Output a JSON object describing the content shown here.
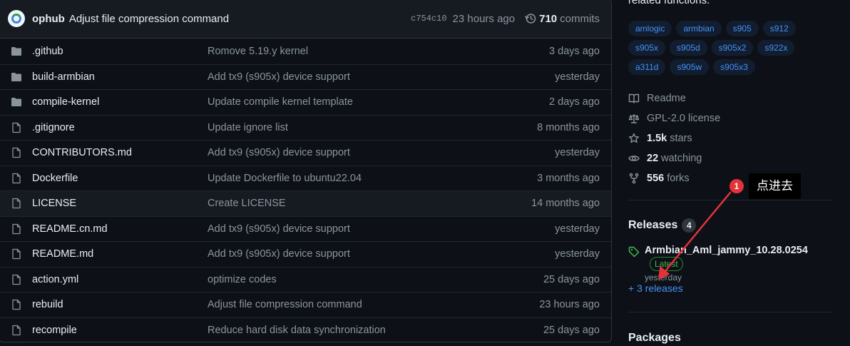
{
  "commit_bar": {
    "author": "ophub",
    "message": "Adjust file compression command",
    "sha": "c754c10",
    "time": "23 hours ago",
    "commits_count": "710",
    "commits_label": "commits"
  },
  "files": [
    {
      "type": "folder",
      "name": ".github",
      "message": "Romove 5.19.y kernel",
      "time": "3 days ago"
    },
    {
      "type": "folder",
      "name": "build-armbian",
      "message": "Add tx9 (s905x) device support",
      "time": "yesterday"
    },
    {
      "type": "folder",
      "name": "compile-kernel",
      "message": "Update compile kernel template",
      "time": "2 days ago"
    },
    {
      "type": "file",
      "name": ".gitignore",
      "message": "Update ignore list",
      "time": "8 months ago"
    },
    {
      "type": "file",
      "name": "CONTRIBUTORS.md",
      "message": "Add tx9 (s905x) device support",
      "time": "yesterday"
    },
    {
      "type": "file",
      "name": "Dockerfile",
      "message": "Update Dockerfile to ubuntu22.04",
      "time": "3 months ago"
    },
    {
      "type": "file",
      "name": "LICENSE",
      "message": "Create LICENSE",
      "time": "14 months ago"
    },
    {
      "type": "file",
      "name": "README.cn.md",
      "message": "Add tx9 (s905x) device support",
      "time": "yesterday"
    },
    {
      "type": "file",
      "name": "README.md",
      "message": "Add tx9 (s905x) device support",
      "time": "yesterday"
    },
    {
      "type": "file",
      "name": "action.yml",
      "message": "optimize codes",
      "time": "25 days ago"
    },
    {
      "type": "file",
      "name": "rebuild",
      "message": "Adjust file compression command",
      "time": "23 hours ago"
    },
    {
      "type": "file",
      "name": "recompile",
      "message": "Reduce hard disk data synchronization",
      "time": "25 days ago"
    }
  ],
  "about": {
    "description_tail": "related functions.",
    "topics": [
      "amlogic",
      "armbian",
      "s905",
      "s912",
      "s905x",
      "s905d",
      "s905x2",
      "s922x",
      "a311d",
      "s905w",
      "s905x3"
    ],
    "readme": "Readme",
    "license": "GPL-2.0 license",
    "stars_count": "1.5k",
    "stars_label": "stars",
    "watching_count": "22",
    "watching_label": "watching",
    "forks_count": "556",
    "forks_label": "forks"
  },
  "releases": {
    "title": "Releases",
    "count": "4",
    "latest_name": "Armbian_Aml_jammy_10.28.0254",
    "latest_badge": "Latest",
    "latest_date": "yesterday",
    "more_link": "+ 3 releases"
  },
  "packages": {
    "title": "Packages"
  },
  "annotation": {
    "number": "1",
    "label": "点进去"
  },
  "colors": {
    "accent": "#4493f8",
    "annotation": "#e5323a",
    "latest": "#3fb950",
    "background": "#0d1117"
  }
}
